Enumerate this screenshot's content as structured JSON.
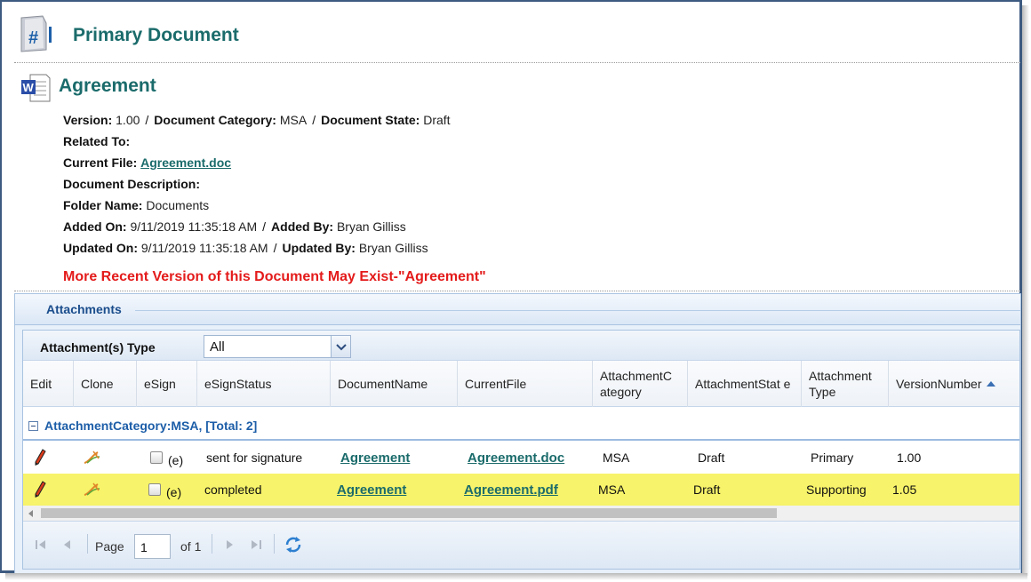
{
  "header": {
    "icon": "document-number-icon",
    "title": "Primary Document"
  },
  "document": {
    "icon": "word-document-icon",
    "title": "Agreement",
    "version_label": "Version:",
    "version": "1.00",
    "category_label": "Document Category:",
    "category": "MSA",
    "state_label": "Document State:",
    "state": "Draft",
    "related_label": "Related To:",
    "current_file_label": "Current File:",
    "current_file": "Agreement.doc",
    "description_label": "Document Description:",
    "folder_label": "Folder Name:",
    "folder": "Documents",
    "added_on_label": "Added On:",
    "added_on": "9/11/2019 11:35:18 AM",
    "added_by_label": "Added By:",
    "added_by": "Bryan Gilliss",
    "updated_on_label": "Updated On:",
    "updated_on": "9/11/2019 11:35:18 AM",
    "updated_by_label": "Updated By:",
    "updated_by": "Bryan Gilliss",
    "separator": "/",
    "warning": "More Recent Version of this Document May Exist-\"Agreement\""
  },
  "attachments": {
    "panel_title": "Attachments",
    "filter_label": "Attachment(s) Type",
    "filter_value": "All",
    "columns": {
      "edit": "Edit",
      "clone": "Clone",
      "esign": "eSign",
      "esign_status": "eSignStatus",
      "document_name": "DocumentName",
      "current_file": "CurrentFile",
      "attachment_category": "AttachmentC ategory",
      "attachment_state": "AttachmentStat e",
      "attachment_type": "Attachment Type",
      "version_number": "VersionNumber"
    },
    "group_label": "AttachmentCategory:MSA, [Total: 2]",
    "esign_suffix": "(e)",
    "rows": [
      {
        "esign_status": "sent for signature",
        "document_name": "Agreement",
        "current_file": "Agreement.doc",
        "category": "MSA",
        "state": "Draft",
        "type": "Primary",
        "version": "1.00"
      },
      {
        "esign_status": "completed",
        "document_name": "Agreement",
        "current_file": "Agreement.pdf",
        "category": "MSA",
        "state": "Draft",
        "type": "Supporting",
        "version": "1.05"
      }
    ],
    "highlight_color": "#f7f36a"
  },
  "pager": {
    "page_label": "Page",
    "page_value": "1",
    "of_label": "of 1"
  },
  "colors": {
    "title": "#1b6b6b",
    "warning": "#e41b1b",
    "group": "#1d5ea8"
  }
}
